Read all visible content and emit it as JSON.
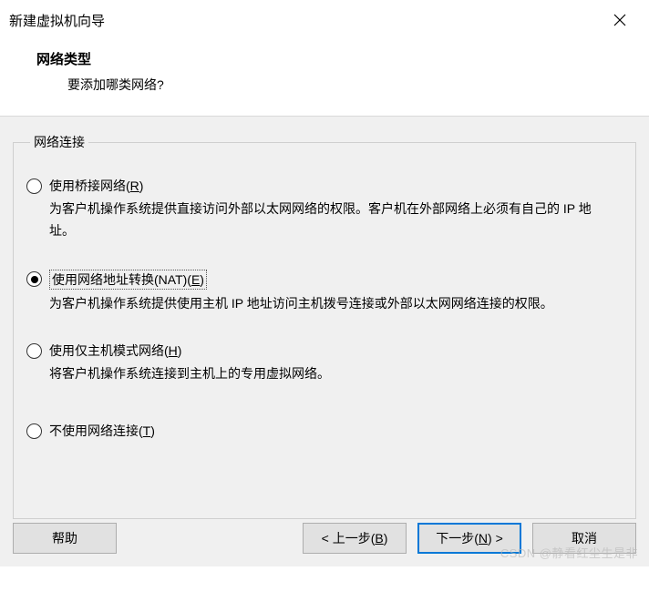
{
  "window": {
    "title": "新建虚拟机向导"
  },
  "header": {
    "heading": "网络类型",
    "subtext": "要添加哪类网络?"
  },
  "group": {
    "legend": "网络连接",
    "options": [
      {
        "label_html": "使用桥接网络(<u>R</u>)",
        "desc": "为客户机操作系统提供直接访问外部以太网网络的权限。客户机在外部网络上必须有自己的 IP 地址。",
        "checked": false
      },
      {
        "label_html": "使用网络地址转换(NAT)(<u>E</u>)",
        "desc": "为客户机操作系统提供使用主机 IP 地址访问主机拨号连接或外部以太网网络连接的权限。",
        "checked": true
      },
      {
        "label_html": "使用仅主机模式网络(<u>H</u>)",
        "desc": "将客户机操作系统连接到主机上的专用虚拟网络。",
        "checked": false
      },
      {
        "label_html": "不使用网络连接(<u>T</u>)",
        "desc": "",
        "checked": false
      }
    ]
  },
  "buttons": {
    "help": "帮助",
    "back_html": "< 上一步(<u>B</u>)",
    "next_html": "下一步(<u>N</u>) >",
    "cancel": "取消"
  },
  "watermark": "CSDN @静看红尘生是非"
}
